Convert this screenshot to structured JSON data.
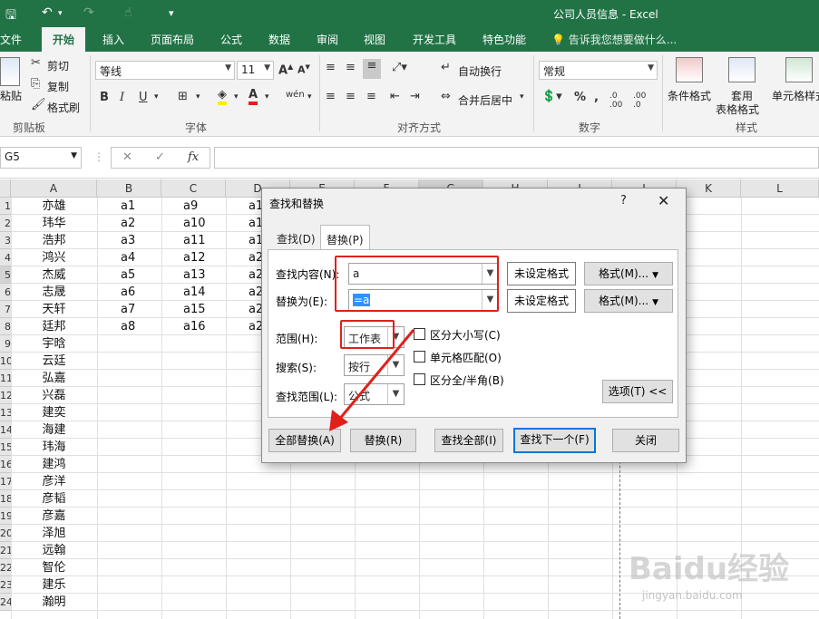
{
  "window": {
    "title": "公司人员信息 - Excel"
  },
  "ribbon_tabs": [
    "文件",
    "开始",
    "插入",
    "页面布局",
    "公式",
    "数据",
    "审阅",
    "视图",
    "开发工具",
    "特色功能"
  ],
  "tell_me": "告诉我您想要做什么...",
  "ribbon": {
    "clipboard": {
      "paste": "粘贴",
      "cut": "剪切",
      "copy": "复制",
      "format_painter": "格式刷",
      "label": "剪贴板"
    },
    "font": {
      "name": "等线",
      "size": "11",
      "label": "字体"
    },
    "alignment": {
      "wrap": "自动换行",
      "merge": "合并后居中",
      "label": "对齐方式"
    },
    "number": {
      "format": "常规",
      "label": "数字"
    },
    "styles": {
      "conditional": "条件格式",
      "table1": "套用",
      "table2": "表格格式",
      "cell": "单元格样式",
      "label": "样式"
    }
  },
  "name_box": "G5",
  "formula_bar": {
    "fx": "fx"
  },
  "columns": [
    "A",
    "B",
    "C",
    "D",
    "E",
    "F",
    "G",
    "H",
    "I",
    "J",
    "K",
    "L"
  ],
  "rows": [
    "1",
    "2",
    "3",
    "4",
    "5",
    "6",
    "7",
    "8",
    "9",
    "10",
    "11",
    "12",
    "13",
    "14",
    "15",
    "16",
    "17",
    "18",
    "19",
    "20",
    "21",
    "22",
    "23",
    "24"
  ],
  "col_a": [
    "亦雄",
    "玮华",
    "浩邦",
    "鸿兴",
    "杰威",
    "志晟",
    "天轩",
    "廷邦",
    "宇晗",
    "云廷",
    "弘嘉",
    "兴磊",
    "建奕",
    "海建",
    "玮海",
    "建鸿",
    "彦洋",
    "彦韬",
    "彦嘉",
    "泽旭",
    "远翰",
    "智伦",
    "建乐",
    "瀚明"
  ],
  "col_b": [
    "a1",
    "a2",
    "a3",
    "a4",
    "a5",
    "a6",
    "a7",
    "a8"
  ],
  "col_c": [
    "a9",
    "a10",
    "a11",
    "a12",
    "a13",
    "a14",
    "a15",
    "a16"
  ],
  "col_d": [
    "a1",
    "a1",
    "a1",
    "a2",
    "a2",
    "a2",
    "a2",
    "a2"
  ],
  "dialog": {
    "title": "查找和替换",
    "help": "?",
    "close": "✕",
    "tab_find": "查找(D)",
    "tab_replace": "替换(P)",
    "find_label": "查找内容(N):",
    "find_value": "a",
    "replace_label": "替换为(E):",
    "replace_value": "=a",
    "format_not_set": "未设定格式",
    "format_btn": "格式(M)...",
    "scope_label": "范围(H):",
    "scope_value": "工作表",
    "search_label": "搜索(S):",
    "search_value": "按行",
    "lookin_label": "查找范围(L):",
    "lookin_value": "公式",
    "match_case": "区分大小写(C)",
    "match_cell": "单元格匹配(O)",
    "match_width": "区分全/半角(B)",
    "options_btn": "选项(T) <<",
    "replace_all": "全部替换(A)",
    "replace": "替换(R)",
    "find_all": "查找全部(I)",
    "find_next": "查找下一个(F)",
    "close_btn": "关闭"
  },
  "watermark": {
    "main": "Baidu经验",
    "sub": "jingyan.baidu.com"
  }
}
